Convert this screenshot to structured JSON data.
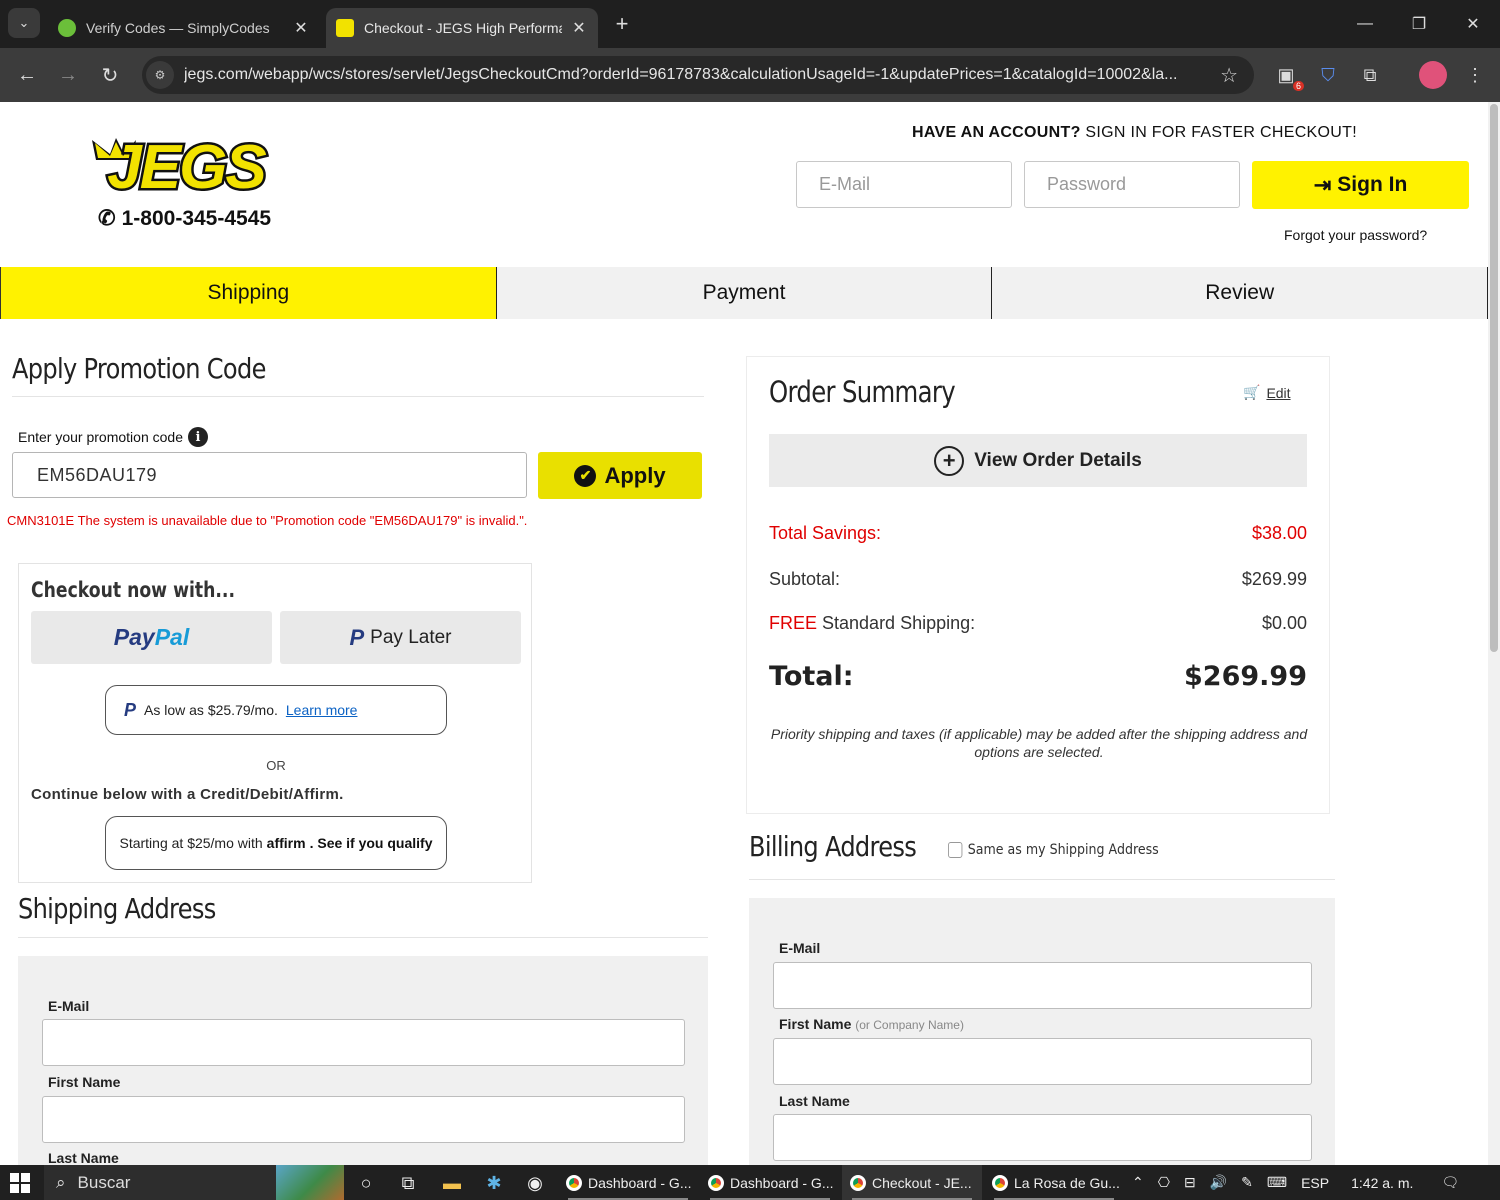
{
  "browser": {
    "tabs": [
      {
        "title": "Verify Codes — SimplyCodes",
        "favicon": "simplycodes-icon",
        "active": false
      },
      {
        "title": "Checkout - JEGS High Performa",
        "favicon": "jegs-icon",
        "active": true
      }
    ],
    "url": "jegs.com/webapp/wcs/stores/servlet/JegsCheckoutCmd?orderId=96178783&calculationUsageId=-1&updatePrices=1&catalogId=10002&la...",
    "extension_badge": "6"
  },
  "header": {
    "logo_text": "JEGS",
    "phone": "1-800-345-4545",
    "account_prompt_bold": "HAVE AN ACCOUNT?",
    "account_prompt_rest": " SIGN IN FOR FASTER CHECKOUT!",
    "email_placeholder": "E-Mail",
    "password_placeholder": "Password",
    "signin_label": "Sign In",
    "forgot_label": "Forgot your password?"
  },
  "steps": [
    {
      "label": "Shipping",
      "active": true
    },
    {
      "label": "Payment",
      "active": false
    },
    {
      "label": "Review",
      "active": false
    }
  ],
  "promo": {
    "title": "Apply Promotion Code",
    "label": "Enter your promotion code",
    "value": "EM56DAU179",
    "apply_label": "Apply",
    "error": "CMN3101E The system is unavailable due to \"Promotion code \"EM56DAU179\" is invalid.\"."
  },
  "express_checkout": {
    "heading": "Checkout now with...",
    "paypal_label_a": "Pay",
    "paypal_label_b": "Pal",
    "paylater_label": "Pay Later",
    "as_low_text": "As low as $25.79/mo.",
    "learn_more": "Learn more",
    "or_text": "OR",
    "continue_text": "Continue below with a Credit/Debit/Affirm.",
    "affirm_prefix": "Starting at $25/mo with",
    "affirm_brand": "affirm",
    "affirm_suffix": ". See if you qualify"
  },
  "shipping_address": {
    "title": "Shipping Address",
    "email_label": "E-Mail",
    "first_name_label": "First Name",
    "last_name_label": "Last Name"
  },
  "order_summary": {
    "title": "Order Summary",
    "edit_label": "Edit",
    "view_details_label": "View Order Details",
    "savings_label": "Total Savings:",
    "savings_value": "$38.00",
    "subtotal_label": "Subtotal:",
    "subtotal_value": "$269.99",
    "shipping_free": "FREE",
    "shipping_label": " Standard Shipping:",
    "shipping_value": "$0.00",
    "total_label": "Total:",
    "total_value": "$269.99",
    "note": "Priority shipping and taxes (if applicable) may be added after the shipping address and options are selected."
  },
  "billing_address": {
    "title": "Billing Address",
    "same_as_shipping": "Same as my Shipping Address",
    "email_label": "E-Mail",
    "first_name_label": "First Name",
    "first_name_hint": "(or Company Name)",
    "last_name_label": "Last Name"
  },
  "taskbar": {
    "search_label": "Buscar",
    "apps": [
      {
        "label": "Dashboard - G...",
        "active": false
      },
      {
        "label": "Dashboard - G...",
        "active": false
      },
      {
        "label": "Checkout - JE...",
        "active": true
      },
      {
        "label": "La Rosa de Gu...",
        "active": false
      }
    ],
    "language": "ESP",
    "time": "1:42 a. m."
  },
  "colors": {
    "jegs_yellow": "#fff200",
    "error_red": "#e00000",
    "paypal_dark": "#253b80",
    "paypal_light": "#179bd7"
  }
}
